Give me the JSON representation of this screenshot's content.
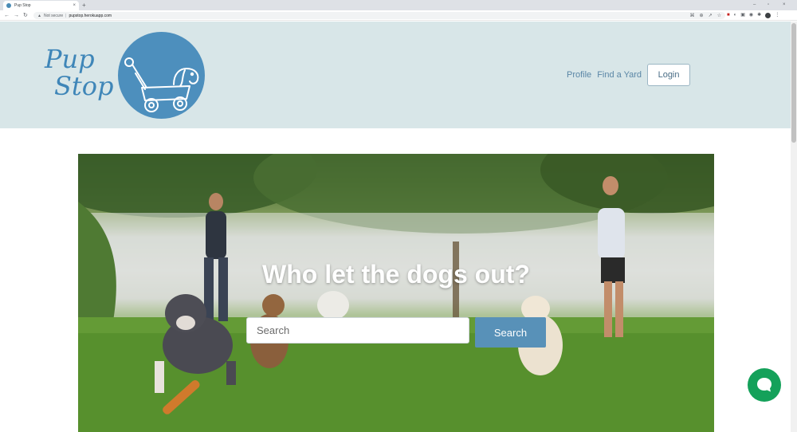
{
  "browser": {
    "tab_title": "Pup Stop",
    "tab_close": "×",
    "new_tab": "+",
    "window_controls": [
      "–",
      "▫",
      "×"
    ],
    "not_secure": "Not secure",
    "url_separator": "|",
    "url": "pupstop.herokuapp.com",
    "nav": {
      "back": "←",
      "forward": "→",
      "reload": "↻"
    }
  },
  "header": {
    "logo_line1": "Pup",
    "logo_line2": "Stop",
    "nav": {
      "profile": "Profile",
      "find_yard": "Find a Yard",
      "login": "Login"
    }
  },
  "hero": {
    "title": "Who let the dogs out?",
    "search_placeholder": "Search",
    "search_button": "Search"
  },
  "colors": {
    "header_bg": "#d8e6e8",
    "brand_blue": "#4d8fbd",
    "search_button": "#5891b8",
    "chat_green": "#14a15a"
  },
  "icons": [
    "warning-icon",
    "zoom-icon",
    "share-icon",
    "star-icon",
    "puzzle-icon",
    "chat-icon",
    "wagon-dog-logo-icon"
  ]
}
